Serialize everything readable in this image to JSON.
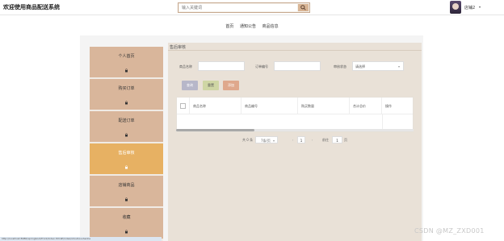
{
  "app": {
    "title": "欢迎使用商品配送系统"
  },
  "search": {
    "placeholder": "输入关键词",
    "icon": "search-icon"
  },
  "user": {
    "name": "店铺2",
    "caret": "▾"
  },
  "topnav": {
    "items": [
      "首页",
      "通知公告",
      "商品信息"
    ]
  },
  "sidebar": {
    "items": [
      {
        "label": "个人首页",
        "active": false
      },
      {
        "label": "购买订单",
        "active": false
      },
      {
        "label": "配送订单",
        "active": false
      },
      {
        "label": "售后审核",
        "active": true
      },
      {
        "label": "店铺商品",
        "active": false
      },
      {
        "label": "收藏",
        "active": false
      }
    ],
    "active_color": "#e7b163",
    "item_color": "#d9b69b"
  },
  "panel": {
    "title": "售后审核"
  },
  "filters": {
    "product_name_label": "商品名称",
    "order_no_label": "订单编号",
    "audit_status_label": "审核状态",
    "audit_status_value": "请选择"
  },
  "buttons": {
    "search": "查询",
    "reset": "重置",
    "add": "添加"
  },
  "table": {
    "columns": [
      "商品名称",
      "商品编号",
      "购买数量",
      "合计总价",
      "操作"
    ]
  },
  "pagination": {
    "total": "共 0 条",
    "page_size": "7条/页",
    "prev": "‹",
    "current_page": "1",
    "next": "›",
    "goto_label": "前往",
    "jump_value": "1",
    "page_label": "页"
  },
  "watermark": "CSDN @MZ_ZXD001",
  "statusbar": "http://localhost:8080/springboot/front/index.html#/index/shouhoushenhe"
}
